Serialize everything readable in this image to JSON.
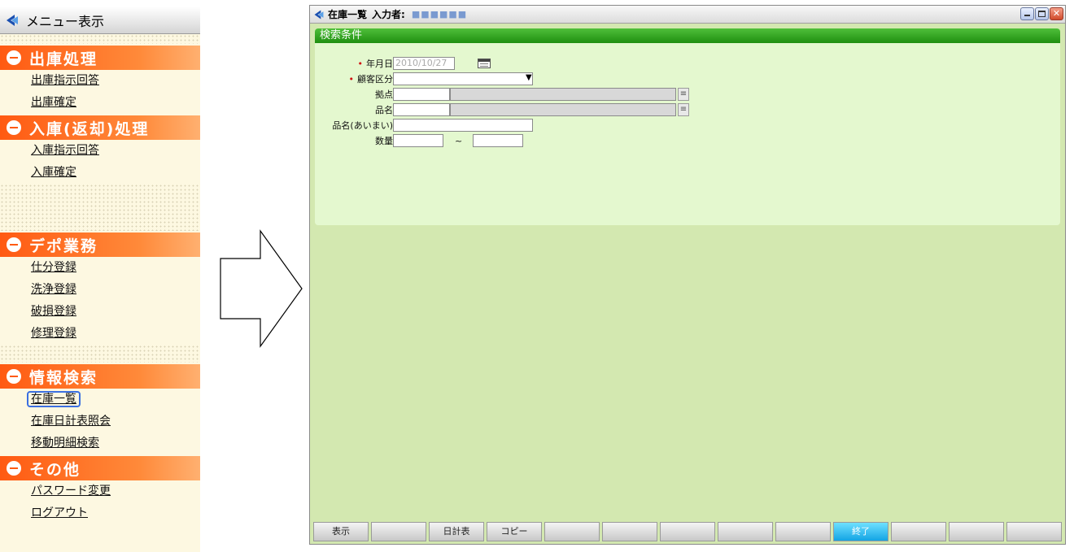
{
  "menu": {
    "title": "メニュー表示",
    "sections": [
      {
        "title": "出庫処理",
        "items": [
          "出庫指示回答",
          "出庫確定"
        ]
      },
      {
        "title": "入庫(返却)処理",
        "items": [
          "入庫指示回答",
          "入庫確定"
        ]
      },
      {
        "title": "デポ業務",
        "items": [
          "仕分登録",
          "洗浄登録",
          "破損登録",
          "修理登録"
        ]
      },
      {
        "title": "情報検索",
        "items": [
          "在庫一覧",
          "在庫日計表照会",
          "移動明細検索"
        ]
      },
      {
        "title": "その他",
        "items": [
          "パスワード変更",
          "ログアウト"
        ]
      }
    ]
  },
  "window": {
    "title": "在庫一覧",
    "user_label": "入力者:",
    "user_value": "■■■■■■"
  },
  "search": {
    "header": "検索条件",
    "fields": {
      "date": {
        "label": "年月日",
        "value": "2010/10/27"
      },
      "customer": {
        "label": "顧客区分",
        "value": ""
      },
      "base": {
        "label": "拠点"
      },
      "product": {
        "label": "品名"
      },
      "product_fuzzy": {
        "label": "品名(あいまい)"
      },
      "quantity": {
        "label": "数量",
        "separator": "~"
      }
    }
  },
  "toolbar": {
    "buttons": [
      "表示",
      "",
      "日計表",
      "コピー",
      "",
      "",
      "",
      "",
      "",
      "終了",
      "",
      "",
      ""
    ]
  },
  "colors": {
    "accent_orange": "#ff5a12",
    "panel_green": "#e4f8cf",
    "header_green": "#1f8f10",
    "active_button": "#14a4e4"
  }
}
